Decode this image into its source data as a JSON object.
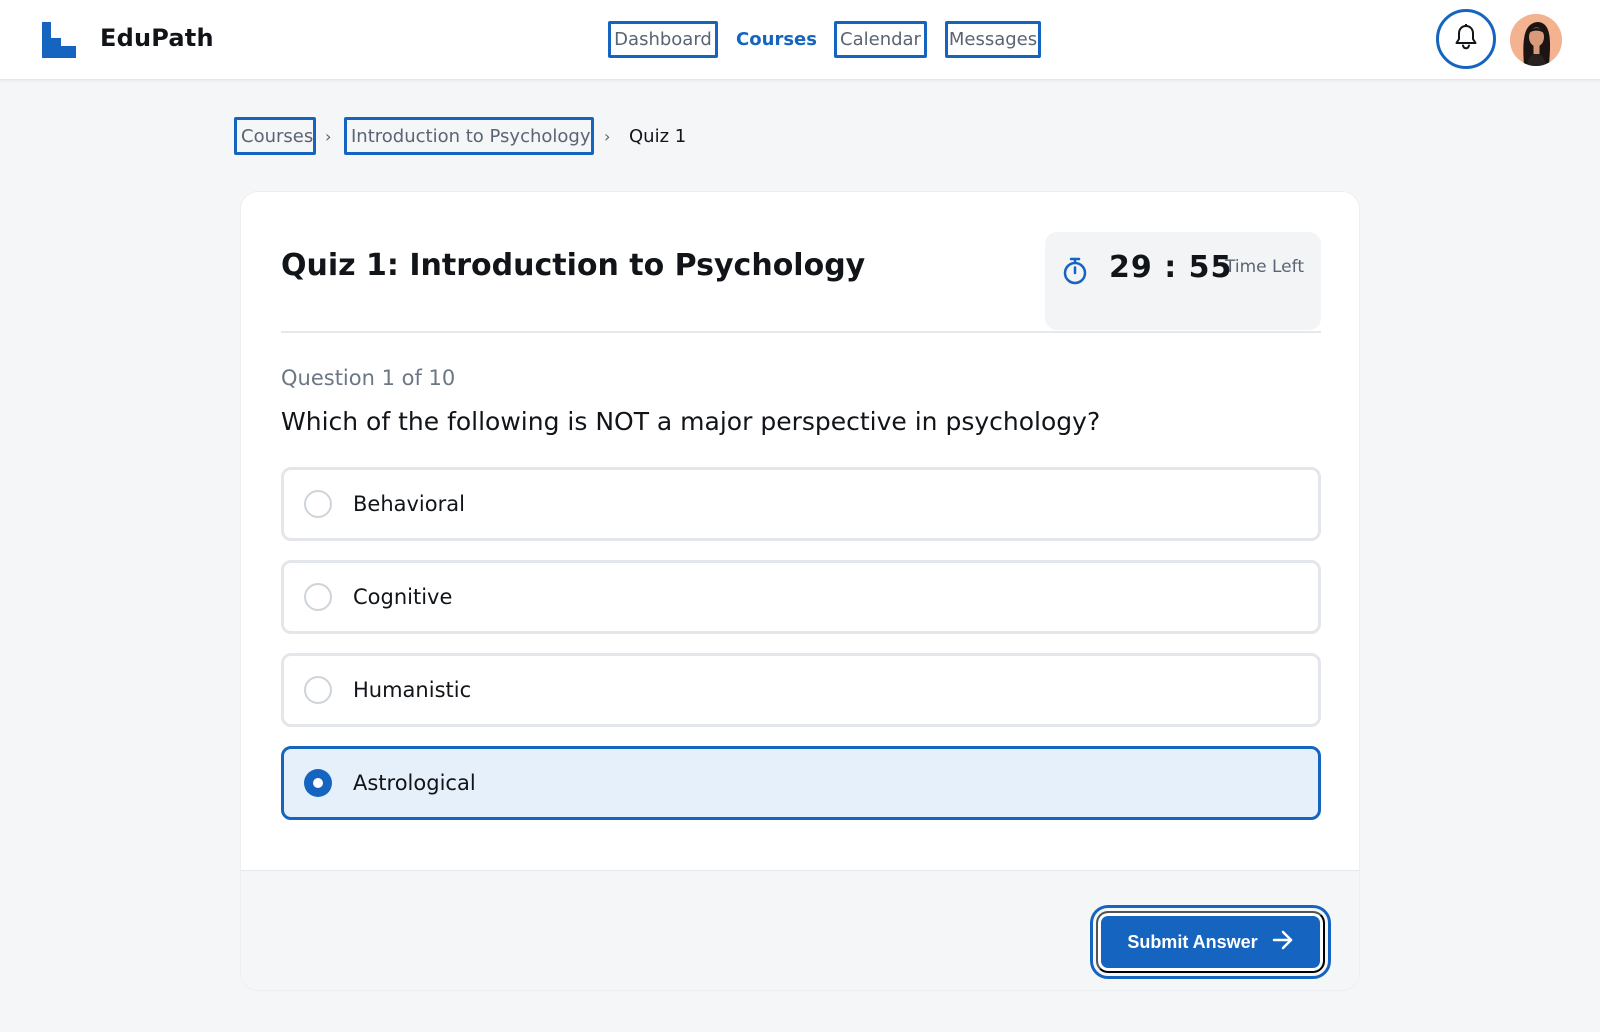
{
  "app": {
    "brand": "EduPath"
  },
  "nav": {
    "items": [
      {
        "label": "Dashboard"
      },
      {
        "label": "Courses"
      },
      {
        "label": "Calendar"
      },
      {
        "label": "Messages"
      }
    ],
    "active": "Courses"
  },
  "breadcrumb": {
    "items": [
      {
        "label": "Courses"
      },
      {
        "label": "Introduction to Psychology"
      },
      {
        "label": "Quiz 1"
      }
    ],
    "separator": "›"
  },
  "quiz": {
    "title": "Quiz 1: Introduction to Psychology",
    "timer": {
      "value": "29 : 55",
      "label": "Time Left"
    },
    "question_counter": "Question 1 of 10",
    "question_text": "Which of the following is NOT a major perspective in psychology?",
    "options": [
      {
        "label": "Behavioral",
        "selected": false
      },
      {
        "label": "Cognitive",
        "selected": false
      },
      {
        "label": "Humanistic",
        "selected": false
      },
      {
        "label": "Astrological",
        "selected": true
      }
    ],
    "submit_label": "Submit Answer"
  },
  "icons": {
    "logo": "edupath-logo-icon",
    "notifications": "bell-icon",
    "timer": "stopwatch-icon",
    "submit": "arrow-right-icon"
  },
  "colors": {
    "accent": "#1565c0",
    "selected_bg": "#e6f0fa",
    "page_bg": "#f4f6f8",
    "avatar_bg": "#f3b391"
  }
}
